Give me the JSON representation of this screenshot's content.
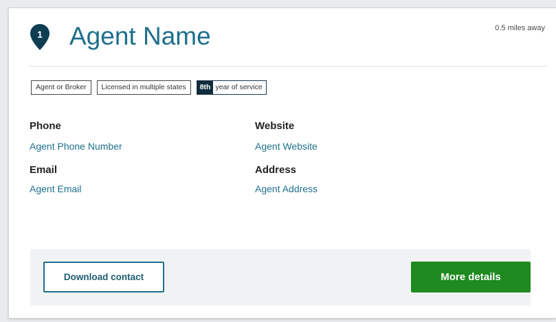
{
  "agent": {
    "index": "1",
    "name": "Agent Name",
    "distance": "0.5 miles away"
  },
  "tags": {
    "type": "Agent or Broker",
    "license": "Licensed in multiple states",
    "service_rank": "8th",
    "service_label": "year of service"
  },
  "contact": {
    "phone_label": "Phone",
    "phone_value": "Agent Phone Number",
    "website_label": "Website",
    "website_value": "Agent Website",
    "email_label": "Email",
    "email_value": "Agent Email",
    "address_label": "Address",
    "address_value": "Agent Address"
  },
  "actions": {
    "download_label": "Download contact",
    "more_label": "More details"
  },
  "icons": {
    "pin": "map-pin-icon"
  },
  "colors": {
    "accent": "#1d6f8c",
    "pin": "#0f3e52",
    "primary_button": "#1f8a1f"
  }
}
